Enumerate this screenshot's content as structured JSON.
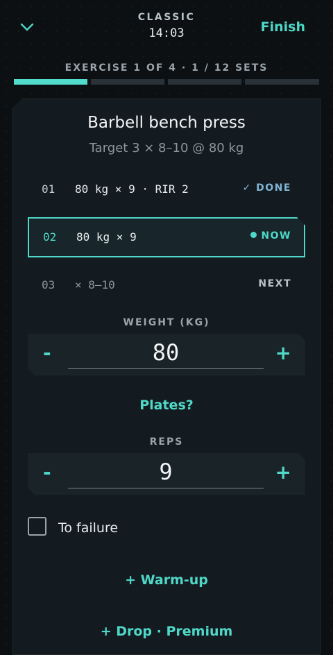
{
  "header": {
    "mode": "CLASSIC",
    "timer": "14:03",
    "finish": "Finish"
  },
  "progress": {
    "label": "EXERCISE 1 OF 4 · 1 / 12 SETS",
    "segments": 4,
    "active_segment": 1,
    "completed_sets": 1,
    "total_sets": 12
  },
  "exercise": {
    "name": "Barbell bench press",
    "target": "Target 3 × 8–10 @ 80 kg"
  },
  "sets": [
    {
      "num": "01",
      "desc": "80 kg × 9 · RIR 2",
      "status": "✓ DONE"
    },
    {
      "num": "02",
      "desc": "80 kg × 9",
      "status": "NOW"
    },
    {
      "num": "03",
      "desc": "× 8–10",
      "status": "NEXT"
    }
  ],
  "weight": {
    "label": "WEIGHT (KG)",
    "value": "80",
    "minus": "-",
    "plus": "+"
  },
  "plates_link": "Plates?",
  "reps": {
    "label": "REPS",
    "value": "9",
    "minus": "-",
    "plus": "+"
  },
  "to_failure": {
    "label": "To failure",
    "checked": false
  },
  "warmup_link": "+ Warm-up",
  "drop_link": "+ Drop · Premium",
  "colors": {
    "accent": "#4fd8c8",
    "done": "#7fb4d3",
    "background": "#0c1013",
    "card": "#141b20"
  },
  "icons": {
    "collapse": "chevron-down-icon",
    "now_indicator": "dot-icon"
  }
}
